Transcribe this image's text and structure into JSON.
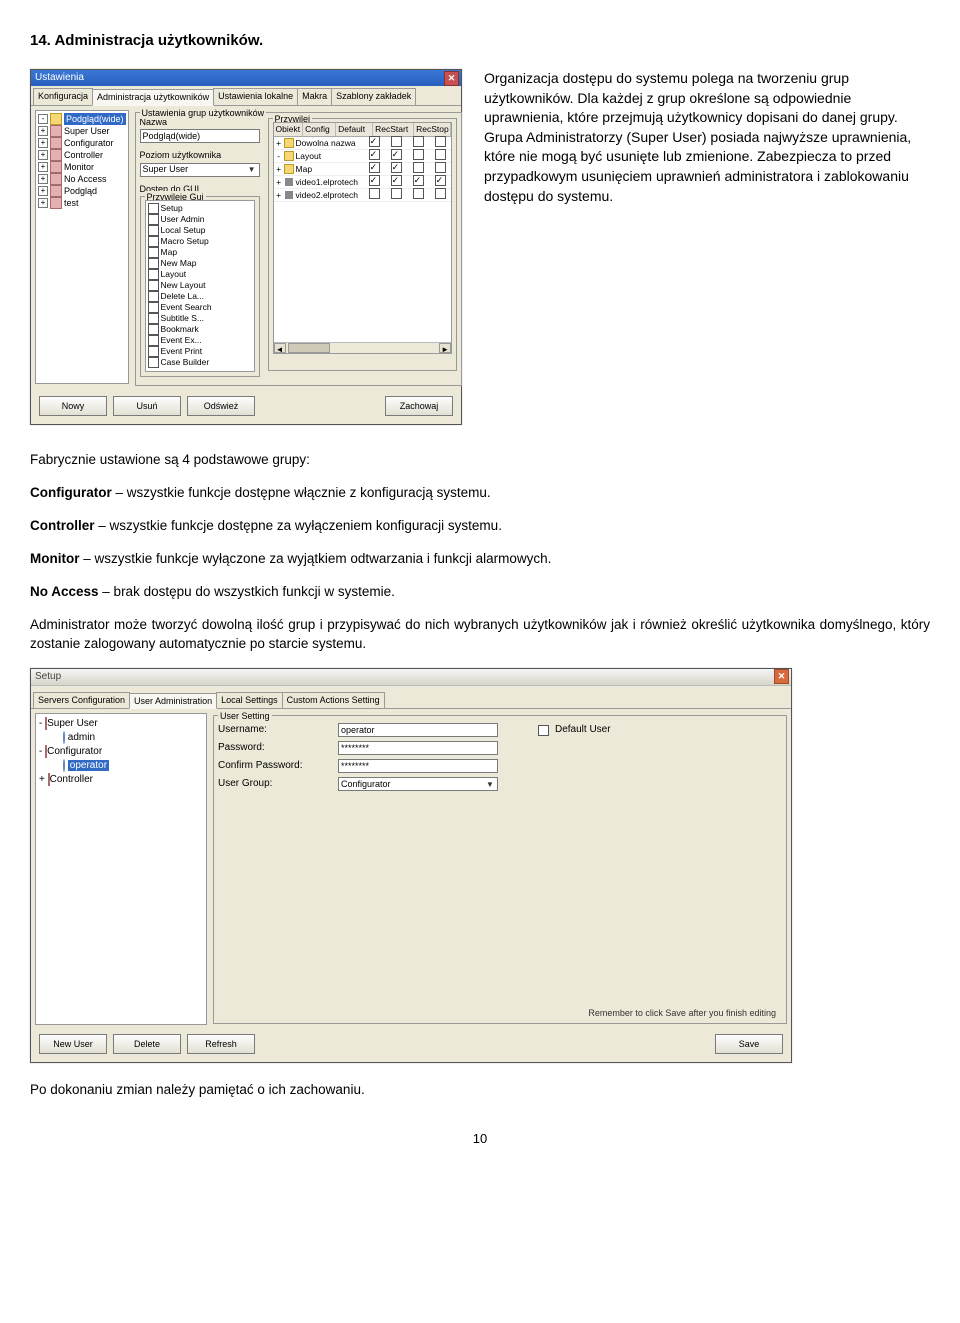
{
  "doc": {
    "heading": "14. Administracja użytkowników.",
    "side_paragraph": "Organizacja dostępu do systemu polega na tworzeniu grup użytkowników. Dla każdej z grup określone są odpowiednie uprawnienia, które przejmują użytkownicy dopisani do danej grupy. Grupa Administratorzy (Super User) posiada najwyższe uprawnienia, które nie mogą być usunięte lub zmienione. Zabezpiecza to przed przypadkowym usunięciem uprawnień administratora i zablokowaniu dostępu do systemu.",
    "p_intro": "Fabrycznie ustawione są 4 podstawowe grupy:",
    "p_configurator_b": "Configurator",
    "p_configurator": " – wszystkie funkcje dostępne włącznie z konfiguracją systemu.",
    "p_controller_b": "Controller",
    "p_controller": " – wszystkie funkcje dostępne za wyłączeniem konfiguracji systemu.",
    "p_monitor_b": "Monitor",
    "p_monitor": " – wszystkie funkcje wyłączone za wyjątkiem odtwarzania i funkcji alarmowych.",
    "p_noaccess_b": "No Access",
    "p_noaccess": " – brak dostępu do wszystkich funkcji w systemie.",
    "p_admin": "Administrator może tworzyć dowolną ilość grup i przypisywać do nich wybranych użytkowników jak i również określić użytkownika domyślnego, który zostanie zalogowany automatycznie po starcie systemu.",
    "p_last": "Po dokonaniu zmian należy pamiętać o ich zachowaniu.",
    "page_num": "10"
  },
  "win1": {
    "title": "Ustawienia",
    "tabs": [
      "Konfiguracja",
      "Administracja użytkowników",
      "Ustawienia lokalne",
      "Makra",
      "Szablony zakładek"
    ],
    "active_tab": 1,
    "left_tree": [
      {
        "lvl": 0,
        "box": "-",
        "icon": "folder",
        "text": "Podgląd(wide)",
        "sel": true
      },
      {
        "lvl": 0,
        "box": "+",
        "icon": "group",
        "text": "Super User"
      },
      {
        "lvl": 0,
        "box": "+",
        "icon": "group",
        "text": "Configurator"
      },
      {
        "lvl": 0,
        "box": "+",
        "icon": "group",
        "text": "Controller"
      },
      {
        "lvl": 0,
        "box": "+",
        "icon": "group",
        "text": "Monitor"
      },
      {
        "lvl": 0,
        "box": "+",
        "icon": "group",
        "text": "No Access"
      },
      {
        "lvl": 0,
        "box": "+",
        "icon": "group",
        "text": "Podgląd"
      },
      {
        "lvl": 0,
        "box": "+",
        "icon": "group",
        "text": "test"
      }
    ],
    "group_settings_legend": "Ustawienia grup użytkowników",
    "name_label": "Nazwa",
    "name_value": "Podgląd(wide)",
    "level_label": "Poziom użytkownika",
    "level_value": "Super User",
    "gui_label": "Dostęp do GUI",
    "gui_legend": "Przywileje Gui",
    "gui_items": [
      "Setup",
      "User Admin",
      "Local Setup",
      "Macro Setup",
      "Map",
      "New Map",
      "Layout",
      "New Layout",
      "Delete La...",
      "Event Search",
      "Subtitle S...",
      "Bookmark",
      "Event Ex...",
      "Event Print",
      "Case Builder"
    ],
    "priv_legend": "Przywilej",
    "priv_headers": [
      "Obiekt",
      "Config",
      "Default",
      "RecStart",
      "RecStop"
    ],
    "priv_rows": [
      {
        "exp": "+",
        "icon": true,
        "label": "Dowolna nazwa",
        "c": [
          true,
          false,
          false,
          false
        ]
      },
      {
        "exp": "-",
        "icon": true,
        "label": "Layout",
        "c": [
          true,
          true,
          false,
          false
        ]
      },
      {
        "exp": "+",
        "icon": true,
        "label": "Map",
        "c": [
          true,
          true,
          false,
          false
        ]
      },
      {
        "exp": "+",
        "icon": false,
        "label": "video1.elprotech",
        "c": [
          true,
          true,
          true,
          true
        ]
      },
      {
        "exp": "+",
        "icon": false,
        "label": "video2.elprotech",
        "c": [
          false,
          false,
          false,
          false
        ]
      }
    ],
    "buttons": {
      "new": "Nowy",
      "delete": "Usuń",
      "refresh": "Odśwież",
      "save": "Zachowaj"
    }
  },
  "win2": {
    "title": "Setup",
    "tabs": [
      "Servers Configuration",
      "User Administration",
      "Local Settings",
      "Custom Actions Setting"
    ],
    "active_tab": 1,
    "tree": [
      {
        "lvl": 0,
        "box": "-",
        "icon": "group",
        "text": "Super User"
      },
      {
        "lvl": 1,
        "box": "",
        "icon": "user",
        "text": "admin"
      },
      {
        "lvl": 0,
        "box": "-",
        "icon": "group",
        "text": "Configurator"
      },
      {
        "lvl": 1,
        "box": "",
        "icon": "user",
        "text": "operator",
        "sel": true
      },
      {
        "lvl": 0,
        "box": "+",
        "icon": "group",
        "text": "Controller"
      }
    ],
    "legend": "User Setting",
    "labels": {
      "username": "Username:",
      "password": "Password:",
      "confirm": "Confirm Password:",
      "group": "User Group:",
      "default": "Default User"
    },
    "values": {
      "username": "operator",
      "password": "********",
      "confirm": "********",
      "group": "Configurator"
    },
    "hint": "Remember to click Save after you finish editing",
    "buttons": {
      "new": "New User",
      "delete": "Delete",
      "refresh": "Refresh",
      "save": "Save"
    }
  }
}
